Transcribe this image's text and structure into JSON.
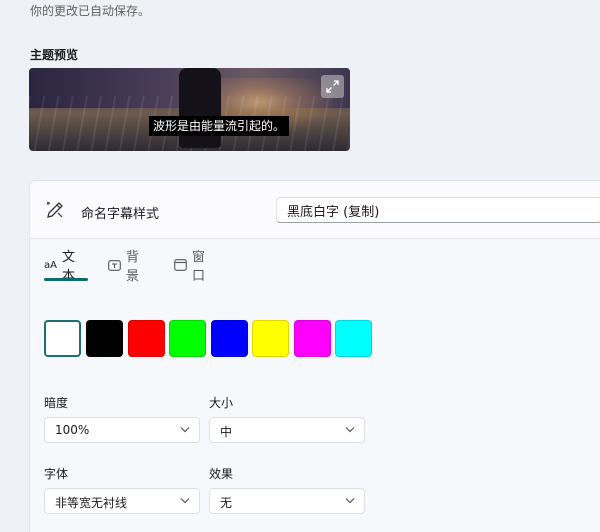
{
  "autosave_text": "你的更改已自动保存。",
  "preview": {
    "title": "主题预览",
    "caption": "波形是由能量流引起的。"
  },
  "name_row": {
    "label": "命名字幕样式",
    "value": "黑底白字 (复制)"
  },
  "tabs": [
    {
      "label": "文本",
      "icon": "text-size-icon",
      "active": true
    },
    {
      "label": "背景",
      "icon": "background-icon",
      "active": false
    },
    {
      "label": "窗口",
      "icon": "window-icon",
      "active": false
    }
  ],
  "tab_text_prefix": "aA",
  "colors": [
    {
      "name": "white",
      "hex": "#ffffff",
      "selected": true
    },
    {
      "name": "black",
      "hex": "#000000",
      "selected": false
    },
    {
      "name": "red",
      "hex": "#ff0000",
      "selected": false
    },
    {
      "name": "green",
      "hex": "#00ff00",
      "selected": false
    },
    {
      "name": "blue",
      "hex": "#0000ff",
      "selected": false
    },
    {
      "name": "yellow",
      "hex": "#ffff00",
      "selected": false
    },
    {
      "name": "magenta",
      "hex": "#ff00ff",
      "selected": false
    },
    {
      "name": "cyan",
      "hex": "#00ffff",
      "selected": false
    }
  ],
  "fields": {
    "opacity": {
      "label": "暗度",
      "value": "100%"
    },
    "size": {
      "label": "大小",
      "value": "中"
    },
    "font": {
      "label": "字体",
      "value": "非等宽无衬线"
    },
    "effect": {
      "label": "效果",
      "value": "无"
    }
  },
  "accent": "#0f6b6b"
}
